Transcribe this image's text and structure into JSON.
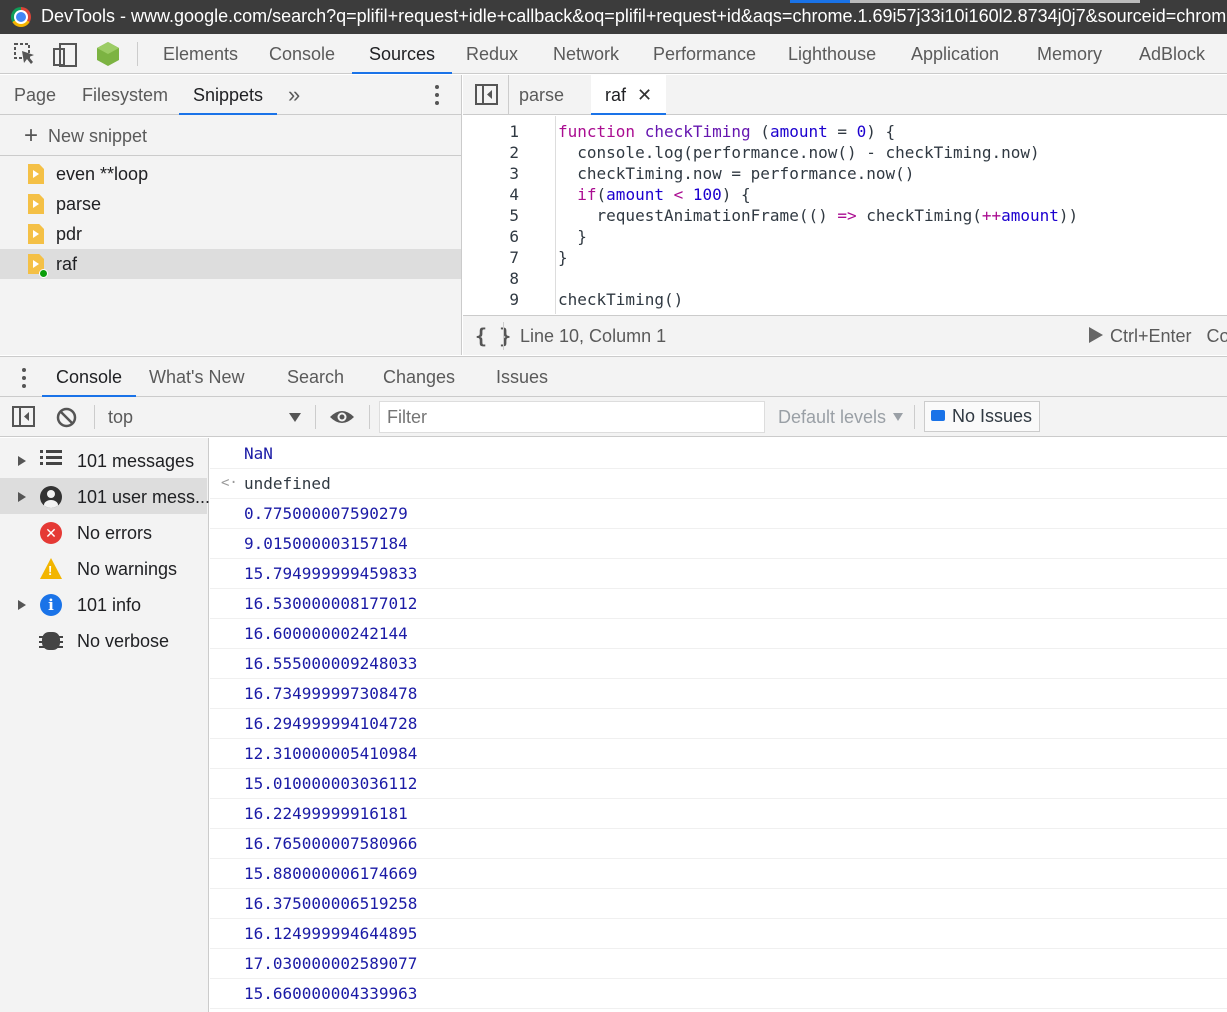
{
  "window": {
    "title": "DevTools - www.google.com/search?q=plifil+request+idle+callback&oq=plifil+request+id&aqs=chrome.1.69i57j33i10i160l2.8734j0j7&sourceid=chrome"
  },
  "main_tabs": [
    "Elements",
    "Console",
    "Sources",
    "Redux",
    "Network",
    "Performance",
    "Lighthouse",
    "Application",
    "Memory",
    "AdBlock"
  ],
  "main_tab_active": "Sources",
  "navigator": {
    "tabs": [
      "Page",
      "Filesystem",
      "Snippets"
    ],
    "active_tab": "Snippets",
    "more": "»",
    "new_snippet": "New snippet",
    "snippets": [
      "even **loop",
      "parse",
      "pdr",
      "raf"
    ],
    "selected_snippet": "raf"
  },
  "editor": {
    "tabs": [
      {
        "label": "parse",
        "active": false
      },
      {
        "label": "raf",
        "active": true,
        "close": "✕"
      }
    ],
    "line_numbers": [
      "1",
      "2",
      "3",
      "4",
      "5",
      "6",
      "7",
      "8",
      "9"
    ],
    "code": {
      "l1": {
        "kw": "function",
        "fn": "checkTiming",
        "p1": " (",
        "arg": "amount",
        "eq": " = ",
        "num": "0",
        "p2": ") {"
      },
      "l2": "  console.log(performance.now() - checkTiming.now)",
      "l3": "  checkTiming.now = performance.now()",
      "l4": {
        "kw": "  if",
        "p1": "(",
        "arg": "amount",
        "op": " < ",
        "num": "100",
        "p2": ") {"
      },
      "l5": {
        "a": "    requestAnimationFrame(() ",
        "op": "=>",
        "b": " checkTiming(",
        "inc": "++",
        "arg": "amount",
        "c": "))"
      },
      "l6": "  }",
      "l7": "}",
      "l8": "",
      "l9": "checkTiming()"
    },
    "status": {
      "braces": "{ }",
      "position": "Line 10, Column 1",
      "run": "Ctrl+Enter",
      "run_more": "Co"
    }
  },
  "drawer": {
    "tabs": [
      "Console",
      "What's New",
      "Search",
      "Changes",
      "Issues"
    ],
    "active_tab": "Console"
  },
  "console_toolbar": {
    "context": "top",
    "filter_placeholder": "Filter",
    "levels": "Default levels",
    "issues": "No Issues"
  },
  "console_sidebar": [
    {
      "label": "101 messages",
      "icon": "list-icon",
      "expandable": true
    },
    {
      "label": "101 user mess...",
      "icon": "user-icon",
      "expandable": true,
      "selected": true
    },
    {
      "label": "No errors",
      "icon": "error-icon",
      "expandable": false
    },
    {
      "label": "No warnings",
      "icon": "warning-icon",
      "expandable": false
    },
    {
      "label": "101 info",
      "icon": "info-icon",
      "expandable": true
    },
    {
      "label": "No verbose",
      "icon": "bug-icon",
      "expandable": false
    }
  ],
  "console_messages": [
    {
      "text": "NaN",
      "type": "log"
    },
    {
      "text": "undefined",
      "type": "return",
      "arrow": "<·"
    },
    {
      "text": "0.775000007590279",
      "type": "log"
    },
    {
      "text": "9.015000003157184",
      "type": "log"
    },
    {
      "text": "15.794999999459833",
      "type": "log"
    },
    {
      "text": "16.530000008177012",
      "type": "log"
    },
    {
      "text": "16.60000000242144",
      "type": "log"
    },
    {
      "text": "16.555000009248033",
      "type": "log"
    },
    {
      "text": "16.734999997308478",
      "type": "log"
    },
    {
      "text": "16.294999994104728",
      "type": "log"
    },
    {
      "text": "12.310000005410984",
      "type": "log"
    },
    {
      "text": "15.010000003036112",
      "type": "log"
    },
    {
      "text": "16.22499999916181",
      "type": "log"
    },
    {
      "text": "16.765000007580966",
      "type": "log"
    },
    {
      "text": "15.880000006174669",
      "type": "log"
    },
    {
      "text": "16.375000006519258",
      "type": "log"
    },
    {
      "text": "16.124999994644895",
      "type": "log"
    },
    {
      "text": "17.030000002589077",
      "type": "log"
    },
    {
      "text": "15.660000004339963",
      "type": "log"
    }
  ],
  "colors": {
    "accent": "#1a73e8",
    "keyword": "#aa0d91",
    "number": "#1c00cf",
    "log_value": "#1a1aa6"
  }
}
